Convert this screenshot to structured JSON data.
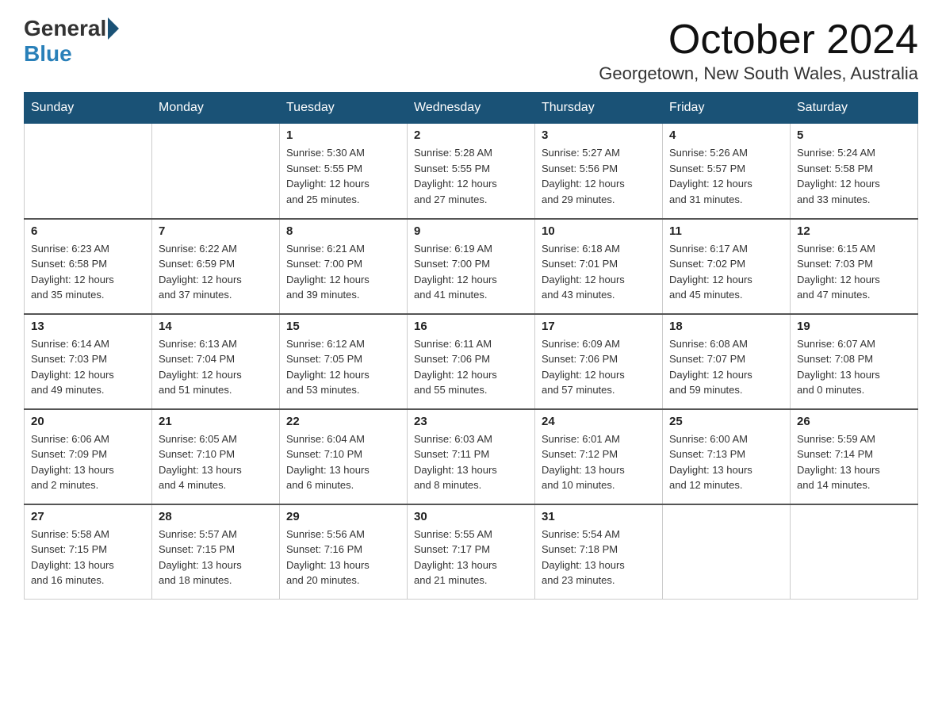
{
  "logo": {
    "general": "General",
    "blue": "Blue"
  },
  "title": "October 2024",
  "location": "Georgetown, New South Wales, Australia",
  "days_header": [
    "Sunday",
    "Monday",
    "Tuesday",
    "Wednesday",
    "Thursday",
    "Friday",
    "Saturday"
  ],
  "weeks": [
    [
      {
        "day": "",
        "info": ""
      },
      {
        "day": "",
        "info": ""
      },
      {
        "day": "1",
        "info": "Sunrise: 5:30 AM\nSunset: 5:55 PM\nDaylight: 12 hours\nand 25 minutes."
      },
      {
        "day": "2",
        "info": "Sunrise: 5:28 AM\nSunset: 5:55 PM\nDaylight: 12 hours\nand 27 minutes."
      },
      {
        "day": "3",
        "info": "Sunrise: 5:27 AM\nSunset: 5:56 PM\nDaylight: 12 hours\nand 29 minutes."
      },
      {
        "day": "4",
        "info": "Sunrise: 5:26 AM\nSunset: 5:57 PM\nDaylight: 12 hours\nand 31 minutes."
      },
      {
        "day": "5",
        "info": "Sunrise: 5:24 AM\nSunset: 5:58 PM\nDaylight: 12 hours\nand 33 minutes."
      }
    ],
    [
      {
        "day": "6",
        "info": "Sunrise: 6:23 AM\nSunset: 6:58 PM\nDaylight: 12 hours\nand 35 minutes."
      },
      {
        "day": "7",
        "info": "Sunrise: 6:22 AM\nSunset: 6:59 PM\nDaylight: 12 hours\nand 37 minutes."
      },
      {
        "day": "8",
        "info": "Sunrise: 6:21 AM\nSunset: 7:00 PM\nDaylight: 12 hours\nand 39 minutes."
      },
      {
        "day": "9",
        "info": "Sunrise: 6:19 AM\nSunset: 7:00 PM\nDaylight: 12 hours\nand 41 minutes."
      },
      {
        "day": "10",
        "info": "Sunrise: 6:18 AM\nSunset: 7:01 PM\nDaylight: 12 hours\nand 43 minutes."
      },
      {
        "day": "11",
        "info": "Sunrise: 6:17 AM\nSunset: 7:02 PM\nDaylight: 12 hours\nand 45 minutes."
      },
      {
        "day": "12",
        "info": "Sunrise: 6:15 AM\nSunset: 7:03 PM\nDaylight: 12 hours\nand 47 minutes."
      }
    ],
    [
      {
        "day": "13",
        "info": "Sunrise: 6:14 AM\nSunset: 7:03 PM\nDaylight: 12 hours\nand 49 minutes."
      },
      {
        "day": "14",
        "info": "Sunrise: 6:13 AM\nSunset: 7:04 PM\nDaylight: 12 hours\nand 51 minutes."
      },
      {
        "day": "15",
        "info": "Sunrise: 6:12 AM\nSunset: 7:05 PM\nDaylight: 12 hours\nand 53 minutes."
      },
      {
        "day": "16",
        "info": "Sunrise: 6:11 AM\nSunset: 7:06 PM\nDaylight: 12 hours\nand 55 minutes."
      },
      {
        "day": "17",
        "info": "Sunrise: 6:09 AM\nSunset: 7:06 PM\nDaylight: 12 hours\nand 57 minutes."
      },
      {
        "day": "18",
        "info": "Sunrise: 6:08 AM\nSunset: 7:07 PM\nDaylight: 12 hours\nand 59 minutes."
      },
      {
        "day": "19",
        "info": "Sunrise: 6:07 AM\nSunset: 7:08 PM\nDaylight: 13 hours\nand 0 minutes."
      }
    ],
    [
      {
        "day": "20",
        "info": "Sunrise: 6:06 AM\nSunset: 7:09 PM\nDaylight: 13 hours\nand 2 minutes."
      },
      {
        "day": "21",
        "info": "Sunrise: 6:05 AM\nSunset: 7:10 PM\nDaylight: 13 hours\nand 4 minutes."
      },
      {
        "day": "22",
        "info": "Sunrise: 6:04 AM\nSunset: 7:10 PM\nDaylight: 13 hours\nand 6 minutes."
      },
      {
        "day": "23",
        "info": "Sunrise: 6:03 AM\nSunset: 7:11 PM\nDaylight: 13 hours\nand 8 minutes."
      },
      {
        "day": "24",
        "info": "Sunrise: 6:01 AM\nSunset: 7:12 PM\nDaylight: 13 hours\nand 10 minutes."
      },
      {
        "day": "25",
        "info": "Sunrise: 6:00 AM\nSunset: 7:13 PM\nDaylight: 13 hours\nand 12 minutes."
      },
      {
        "day": "26",
        "info": "Sunrise: 5:59 AM\nSunset: 7:14 PM\nDaylight: 13 hours\nand 14 minutes."
      }
    ],
    [
      {
        "day": "27",
        "info": "Sunrise: 5:58 AM\nSunset: 7:15 PM\nDaylight: 13 hours\nand 16 minutes."
      },
      {
        "day": "28",
        "info": "Sunrise: 5:57 AM\nSunset: 7:15 PM\nDaylight: 13 hours\nand 18 minutes."
      },
      {
        "day": "29",
        "info": "Sunrise: 5:56 AM\nSunset: 7:16 PM\nDaylight: 13 hours\nand 20 minutes."
      },
      {
        "day": "30",
        "info": "Sunrise: 5:55 AM\nSunset: 7:17 PM\nDaylight: 13 hours\nand 21 minutes."
      },
      {
        "day": "31",
        "info": "Sunrise: 5:54 AM\nSunset: 7:18 PM\nDaylight: 13 hours\nand 23 minutes."
      },
      {
        "day": "",
        "info": ""
      },
      {
        "day": "",
        "info": ""
      }
    ]
  ]
}
